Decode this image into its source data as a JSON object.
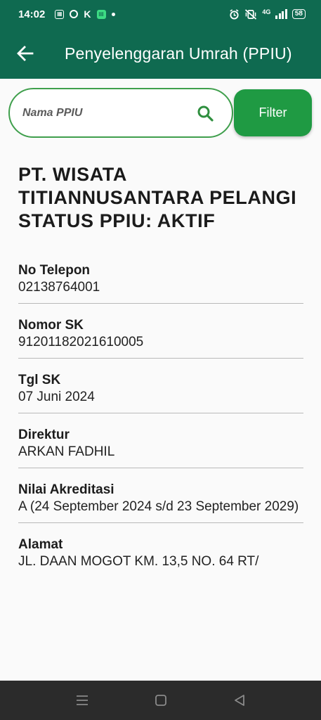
{
  "status_bar": {
    "time": "14:02",
    "battery": "58",
    "network": "4G"
  },
  "header": {
    "title": "Penyelenggaran Umrah (PPIU)"
  },
  "search": {
    "placeholder": "Nama PPIU",
    "filter_label": "Filter"
  },
  "detail": {
    "company_name": "PT. WISATA TITIANNUSANTARA PELANGI",
    "status": "STATUS PPIU: AKTIF",
    "fields": [
      {
        "label": "No Telepon",
        "value": "02138764001"
      },
      {
        "label": "Nomor SK",
        "value": "91201182021610005"
      },
      {
        "label": "Tgl SK",
        "value": "07 Juni 2024"
      },
      {
        "label": "Direktur",
        "value": "ARKAN FADHIL"
      },
      {
        "label": "Nilai Akreditasi",
        "value": "A (24 September 2024 s/d 23 September 2029)"
      },
      {
        "label": "Alamat",
        "value": "JL. DAAN MOGOT KM. 13,5 NO. 64 RT/"
      }
    ]
  },
  "colors": {
    "primary": "#0f6a50",
    "accent": "#1f9a43",
    "search_border": "#3f9f4c"
  },
  "icons": {
    "back": "arrow-left-icon",
    "search": "search-icon",
    "nav_menu": "menu-icon",
    "nav_home": "home-icon",
    "nav_back": "back-triangle-icon"
  }
}
